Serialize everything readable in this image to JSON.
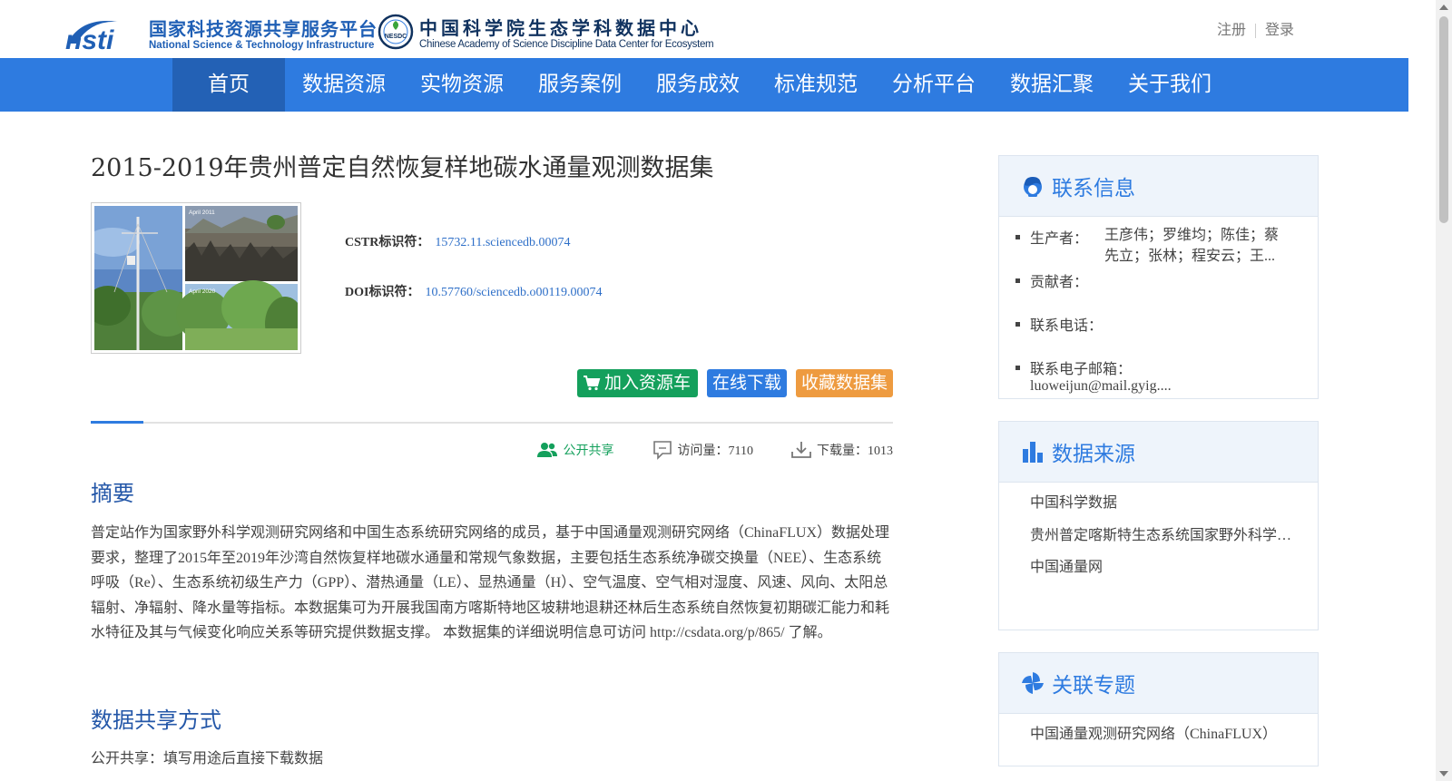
{
  "header": {
    "nsti_cn": "国家科技资源共享服务平台",
    "nsti_en": "National Science & Technology Infrastructure",
    "nsti_mark": "nsti",
    "nesdc_badge": "NESDC",
    "nesdc_cn": "中国科学院生态学科数据中心",
    "nesdc_en": "Chinese Academy of Science Discipline Data Center for Ecosystem",
    "register": "注册",
    "login": "登录"
  },
  "nav": {
    "items": [
      "首页",
      "数据资源",
      "实物资源",
      "服务案例",
      "服务成效",
      "标准规范",
      "分析平台",
      "数据汇聚",
      "关于我们"
    ],
    "active_index": 0
  },
  "dataset": {
    "title": "2015-2019年贵州普定自然恢复样地碳水通量观测数据集",
    "thumb_labels": [
      "April 2011",
      "April 2020"
    ],
    "cstr_label": "CSTR标识符：",
    "cstr_value": "15732.11.sciencedb.00074",
    "doi_label": "DOI标识符：",
    "doi_value": "10.57760/sciencedb.o00119.00074",
    "btn_cart": "加入资源车",
    "btn_download": "在线下载",
    "btn_favorite": "收藏数据集",
    "stat_share": "公开共享",
    "stat_visits": "访问量：7110",
    "stat_downloads": "下载量：1013",
    "abstract_heading": "摘要",
    "abstract_text": "普定站作为国家野外科学观测研究网络和中国生态系统研究网络的成员，基于中国通量观测研究网络（ChinaFLUX）数据处理要求，整理了2015年至2019年沙湾自然恢复样地碳水通量和常规气象数据，主要包括生态系统净碳交换量（NEE）、生态系统呼吸（Re）、生态系统初级生产力（GPP）、潜热通量（LE）、显热通量（H）、空气温度、空气相对湿度、风速、风向、太阳总辐射、净辐射、降水量等指标。本数据集可为开展我国南方喀斯特地区坡耕地退耕还林后生态系统自然恢复初期碳汇能力和耗水特征及其与气候变化响应关系等研究提供数据支撑。 本数据集的详细说明信息可访问 http://csdata.org/p/865/ 了解。",
    "share_heading": "数据共享方式",
    "share_text": "公开共享：填写用途后直接下载数据"
  },
  "sidebar": {
    "contact": {
      "title": "联系信息",
      "producer_label": "生产者：",
      "producer_value": "王彦伟；罗维均；陈佳；蔡先立；张林；程安云；王...",
      "contributor_label": "贡献者：",
      "phone_label": "联系电话：",
      "email_label": "联系电子邮箱：",
      "email_value": "luoweijun@mail.gyig...."
    },
    "source": {
      "title": "数据来源",
      "items": [
        "中国科学数据",
        "贵州普定喀斯特生态系统国家野外科学观测研究站",
        "中国通量网"
      ]
    },
    "topic": {
      "title": "关联专题",
      "items": [
        "中国通量观测研究网络（ChinaFLUX）"
      ]
    }
  },
  "colors": {
    "nav_bg": "#2e7be0",
    "nav_active": "#2361b5",
    "heading": "#2457a8",
    "link": "#2e6fc8",
    "green": "#14a05c",
    "orange": "#ee9b40"
  }
}
